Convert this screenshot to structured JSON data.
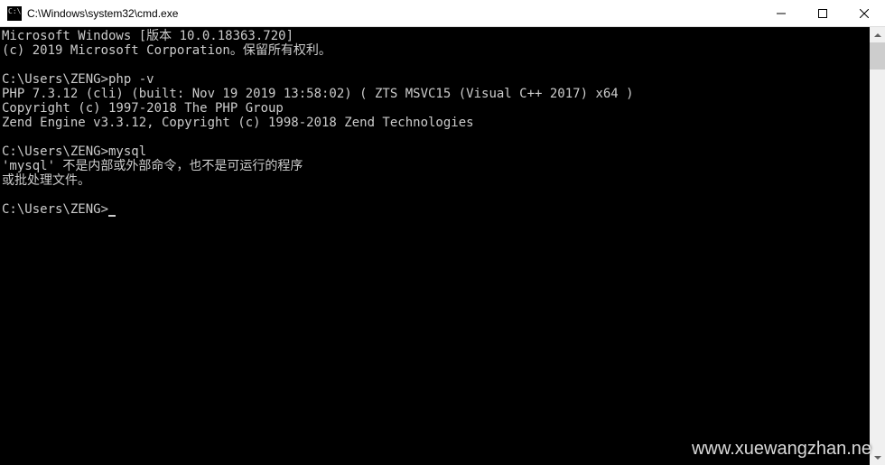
{
  "window": {
    "title": "C:\\Windows\\system32\\cmd.exe"
  },
  "terminal": {
    "lines": [
      "Microsoft Windows [版本 10.0.18363.720]",
      "(c) 2019 Microsoft Corporation。保留所有权利。",
      "",
      "C:\\Users\\ZENG>php -v",
      "PHP 7.3.12 (cli) (built: Nov 19 2019 13:58:02) ( ZTS MSVC15 (Visual C++ 2017) x64 )",
      "Copyright (c) 1997-2018 The PHP Group",
      "Zend Engine v3.3.12, Copyright (c) 1998-2018 Zend Technologies",
      "",
      "C:\\Users\\ZENG>mysql",
      "'mysql' 不是内部或外部命令，也不是可运行的程序",
      "或批处理文件。",
      "",
      "C:\\Users\\ZENG>"
    ],
    "prompt_has_cursor": true
  },
  "watermark": "www.xuewangzhan.ne"
}
